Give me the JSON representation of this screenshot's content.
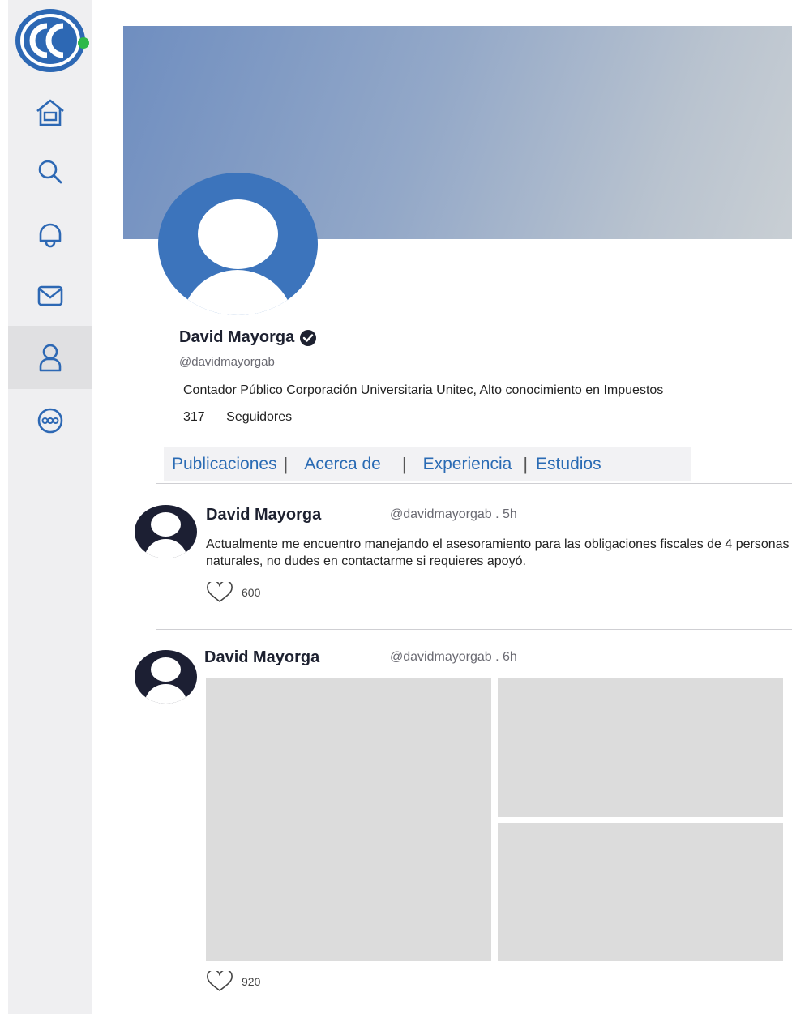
{
  "sidebar": {
    "items": [
      {
        "icon": "home-icon",
        "active": false
      },
      {
        "icon": "search-icon",
        "active": false
      },
      {
        "icon": "bell-icon",
        "active": false
      },
      {
        "icon": "mail-icon",
        "active": false
      },
      {
        "icon": "profile-icon",
        "active": true
      },
      {
        "icon": "more-icon",
        "active": false
      }
    ]
  },
  "profile": {
    "name": "David Mayorga",
    "handle": "@davidmayorgab",
    "bio": "Contador Público Corporación Universitaria Unitec, Alto conocimiento en Impuestos",
    "followers_count": "317",
    "followers_label": "Seguidores"
  },
  "tabs": [
    "Publicaciones",
    "Acerca de",
    "Experiencia",
    "Estudios"
  ],
  "posts": [
    {
      "author": "David Mayorga",
      "meta": "@davidmayorgab . 5h",
      "text": "Actualmente me encuentro manejando el asesoramiento para las obligaciones fiscales de 4 personas naturales, no dudes en contactarme si requieres apoyó.",
      "likes": "600"
    },
    {
      "author": "David Mayorga",
      "meta": "@davidmayorgab . 6h",
      "likes": "920"
    }
  ],
  "colors": {
    "accent": "#2a6bb4",
    "avatar_blue": "#3c74bc",
    "brand_dark": "#1c1f33",
    "online_dot": "#2eb84a"
  }
}
